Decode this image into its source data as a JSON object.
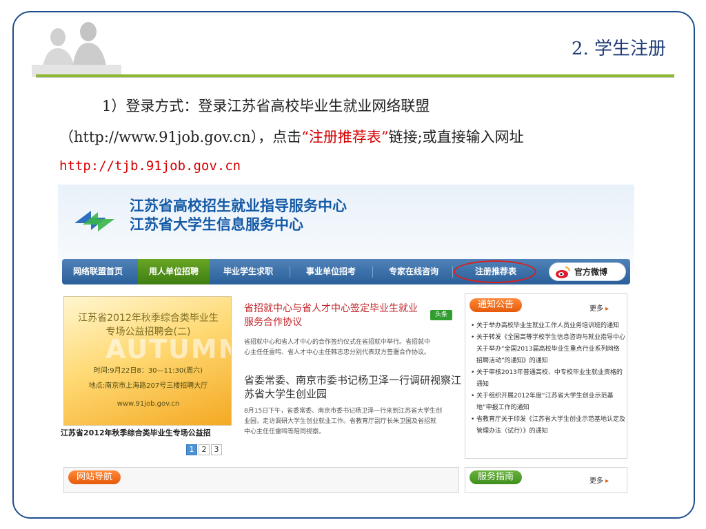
{
  "slide": {
    "title": "2. 学生注册",
    "line1": "1）登录方式：登录江苏省高校毕业生就业网络联盟",
    "line2_prefix": "（http://www.91job.gov.cn），点击",
    "line2_highlight": "“注册推荐表”",
    "line2_suffix": "链接;或直接输入网址",
    "line3_url": "http://tjb.91job.gov.cn"
  },
  "site": {
    "name_line1": "江苏省高校招生就业指导服务中心",
    "name_line2": "江苏省大学生信息服务中心",
    "nav": [
      "网络联盟首页",
      "用人单位招聘",
      "毕业学生求职",
      "事业单位招考",
      "专家在线咨询",
      "注册推荐表"
    ],
    "nav_active": "用人单位招聘",
    "nav_highlighted": "注册推荐表",
    "weibo_label": "官方微博",
    "banner": {
      "line1": "江苏省2012年秋季综合类毕业生",
      "line2": "专场公益招聘会(二)",
      "big_word": "AUTUMN",
      "line3": "时间:9月22日8：30—11:30(周六)",
      "line4": "地点:南京市上海路207号三楼招聘大厅",
      "line5": "www.91job.gov.cn",
      "caption": "江苏省2012年秋季综合类毕业生专场公益招",
      "pages": [
        "1",
        "2",
        "3"
      ],
      "current_page": "1"
    },
    "news": [
      {
        "title_line1": "省招就中心与省人才中心签定毕业生就业",
        "title_line2": "服务合作协议",
        "tag": "头条",
        "body_line1": "省招就中心和省人才中心的合作签约仪式在省招就中举行。省招就中",
        "body_line2": "心主任任雷鸣、省人才中心主任韩志忠分别代表双方签署合作协议。"
      },
      {
        "title_line1": "省委常委、南京市委书记杨卫泽一行调研视察江",
        "title_line2": "苏省大学生创业园",
        "body_line1": "8月15日下午，省委常委、南京市委书记杨卫泽一行来到江苏省大学生创",
        "body_line2": "业园，走访调研大学生创业就业工作。省教育厅副厅长朱卫国及省招就",
        "body_line3": "中心主任任雷鸣等陪同视察。"
      }
    ],
    "notice": {
      "title": "通知公告",
      "more": "更多",
      "items": [
        "关于举办高校毕业生就业工作人员业务培训班的通知",
        "关于转发《全国高等学校学生信息咨询与就业指导中心关于举办“全国2013届高校毕业生重点行业系列网络招聘活动”的通知》的通知",
        "关于审核2013年普通高校、中专校毕业生就业资格的通知",
        "关于组织开展2012年度“江苏省大学生创业示范基地”申报工作的通知",
        "省教育厅关于印发《江苏省大学生创业示范基地认定及管理办法（试行）》的通知"
      ]
    },
    "site_nav_title": "网站导航",
    "service_title": "服务指南",
    "service_more": "更多"
  },
  "colors": {
    "frame": "#1f4e8c",
    "rule": "#8db832",
    "highlight_red": "#d40000",
    "nav_blue": "#2a5f99",
    "nav_active_green": "#3f7d12"
  }
}
